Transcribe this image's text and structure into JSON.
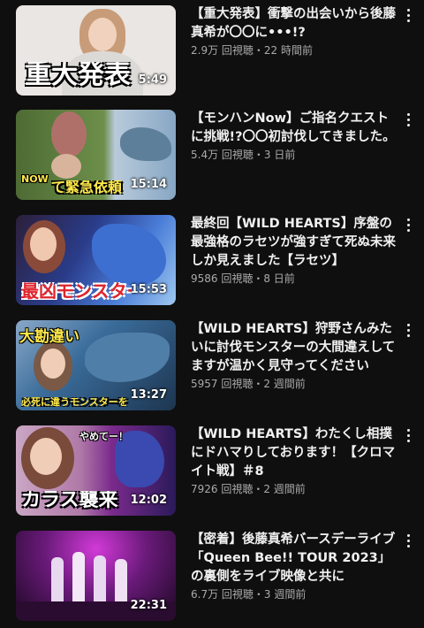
{
  "videos": [
    {
      "title": "【重大発表】衝撃の出会いから後藤真希が〇〇に•••!?",
      "stats": "2.9万 回視聴・22 時間前",
      "duration": "5:49",
      "thumb_text": "重大発表",
      "colors": {
        "bg": "#e9e6e3",
        "accent": "#ffffff"
      }
    },
    {
      "title": "【モンハンNow】ご指名クエストに挑戦!?〇〇初討伐してきました。",
      "stats": "5.4万 回視聴・3 日前",
      "duration": "15:14",
      "thumb_text": "て緊急依頼",
      "thumb_tag": "NOW",
      "colors": {
        "bg": "#5b7a3a",
        "accent": "#ffe94a"
      }
    },
    {
      "title": "最終回【WILD HEARTS】序盤の最強格のラセツが強すぎて死ぬ未来しか見えました【ラセツ】",
      "stats": "9586 回視聴・8 日前",
      "duration": "15:53",
      "thumb_text": "最凶モンスター",
      "colors": {
        "bg": "#2a3c8a",
        "accent": "#e0232b"
      }
    },
    {
      "title": "【WILD HEARTS】狩野さんみたいに討伐モンスターの大間違えしてますが温かく見守ってください",
      "stats": "5957 回視聴・2 週間前",
      "duration": "13:27",
      "thumb_text": "必死に違うモンスターを",
      "thumb_tag": "大勘違い",
      "colors": {
        "bg": "#3a6c9a",
        "accent": "#ffe94a"
      }
    },
    {
      "title": "【WILD HEARTS】わたくし相撲にドハマりしております！【クロマイト戦】＃8",
      "stats": "7926 回視聴・2 週間前",
      "duration": "12:02",
      "thumb_text": "カラス襲来",
      "thumb_tag": "やめてー！",
      "colors": {
        "bg": "#7a2a8c",
        "accent": "#f04a8a"
      }
    },
    {
      "title": "【密着】後藤真希バースデーライブ「Queen Bee!! TOUR 2023」の裏側をライブ映像と共に",
      "stats": "6.7万 回視聴・3 週間前",
      "duration": "22:31",
      "thumb_text": "",
      "colors": {
        "bg": "#3a0f4a",
        "accent": "#d23ad8"
      }
    }
  ]
}
